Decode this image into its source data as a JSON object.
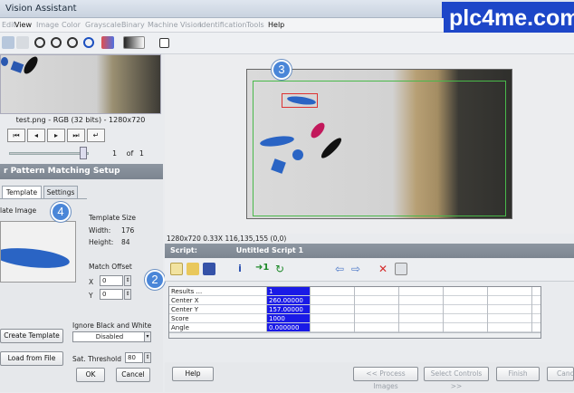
{
  "window": {
    "title": "Vision Assistant"
  },
  "brand": "plc4me.com",
  "menu": [
    "Edit",
    "View",
    "Image",
    "Color",
    "Grayscale",
    "Binary",
    "Machine Vision",
    "Identification",
    "Tools",
    "Help"
  ],
  "menu_active": [
    "View",
    "Help"
  ],
  "thumbnail": {
    "file_label": "test.png - RGB (32 bits) - 1280x720",
    "page": "1",
    "of_label": "of",
    "total": "1"
  },
  "nav_buttons": [
    "first-icon",
    "prev-icon",
    "next-icon",
    "last-icon",
    "return-icon"
  ],
  "setup": {
    "header": "r Pattern Matching Setup",
    "tabs": [
      "Template",
      "Settings"
    ],
    "template_label": "late Image",
    "template_size_label": "Template Size",
    "width_label": "Width:",
    "width_value": "176",
    "height_label": "Height:",
    "height_value": "84",
    "match_offset_label": "Match Offset",
    "x_label": "X",
    "x_value": "0",
    "y_label": "Y",
    "y_value": "0",
    "create_template": "Create Template",
    "ignore_label": "Ignore Black and White",
    "ignore_value": "Disabled",
    "load_from_file": "Load from File",
    "sat_threshold_label": "Sat. Threshold",
    "sat_threshold_value": "80",
    "ok": "OK",
    "cancel": "Cancel"
  },
  "badges": {
    "one": "3",
    "two": "4",
    "three": "2"
  },
  "image_status": "1280x720 0.33X 116,135,155   (0,0)",
  "script": {
    "label": "Script:",
    "name": "Untitled Script 1"
  },
  "results": {
    "labels": [
      "Results ...",
      "Center X",
      "Center Y",
      "Score",
      "Angle"
    ],
    "values": [
      "1",
      "260.00000",
      "157.00000",
      "1000",
      "0.000000"
    ]
  },
  "bottom": {
    "help": "Help",
    "process_images": "<< Process Images",
    "select_controls": "Select Controls >>",
    "finish": "Finish",
    "cancel": "Canc"
  },
  "colors": {
    "accent": "#1d46c8",
    "selection": "#1a1ae6",
    "header": "#7c8590"
  }
}
